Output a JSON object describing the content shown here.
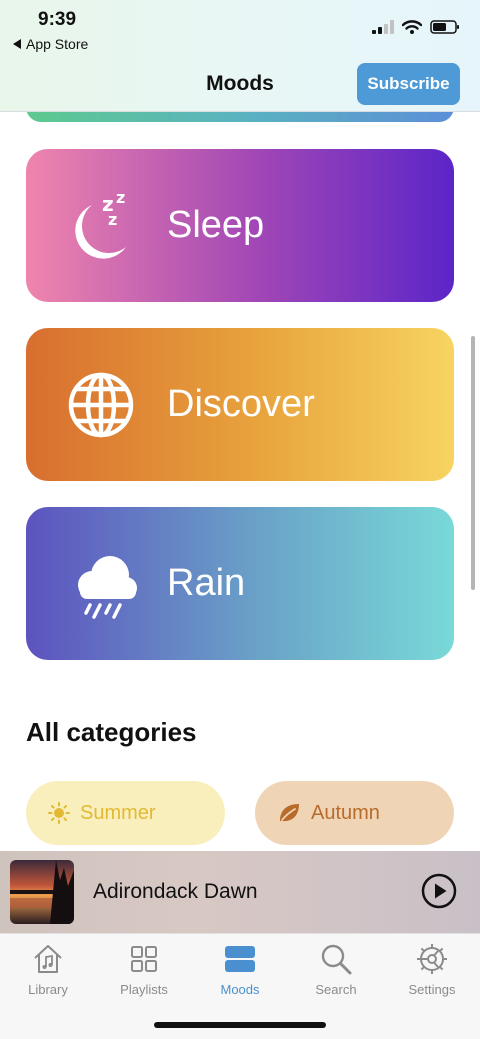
{
  "status_bar": {
    "time": "9:39",
    "back_label": "App Store"
  },
  "header": {
    "title": "Moods",
    "subscribe_label": "Subscribe"
  },
  "moods": [
    {
      "label": "Sleep",
      "icon": "moon-zzz-icon"
    },
    {
      "label": "Discover",
      "icon": "globe-icon"
    },
    {
      "label": "Rain",
      "icon": "rain-cloud-icon"
    }
  ],
  "categories": {
    "title": "All categories",
    "items": [
      {
        "label": "Summer",
        "icon": "sun-icon",
        "color": "#e3b934"
      },
      {
        "label": "Autumn",
        "icon": "leaf-icon",
        "color": "#b86b2a"
      }
    ]
  },
  "player": {
    "track_title": "Adirondack Dawn"
  },
  "tabs": [
    {
      "label": "Library",
      "icon": "house-music-icon"
    },
    {
      "label": "Playlists",
      "icon": "grid-icon"
    },
    {
      "label": "Moods",
      "icon": "moods-icon",
      "active": true
    },
    {
      "label": "Search",
      "icon": "search-icon"
    },
    {
      "label": "Settings",
      "icon": "gear-icon"
    }
  ],
  "colors": {
    "accent": "#4a90d0",
    "subscribe_bg": "#4d9ad7"
  }
}
